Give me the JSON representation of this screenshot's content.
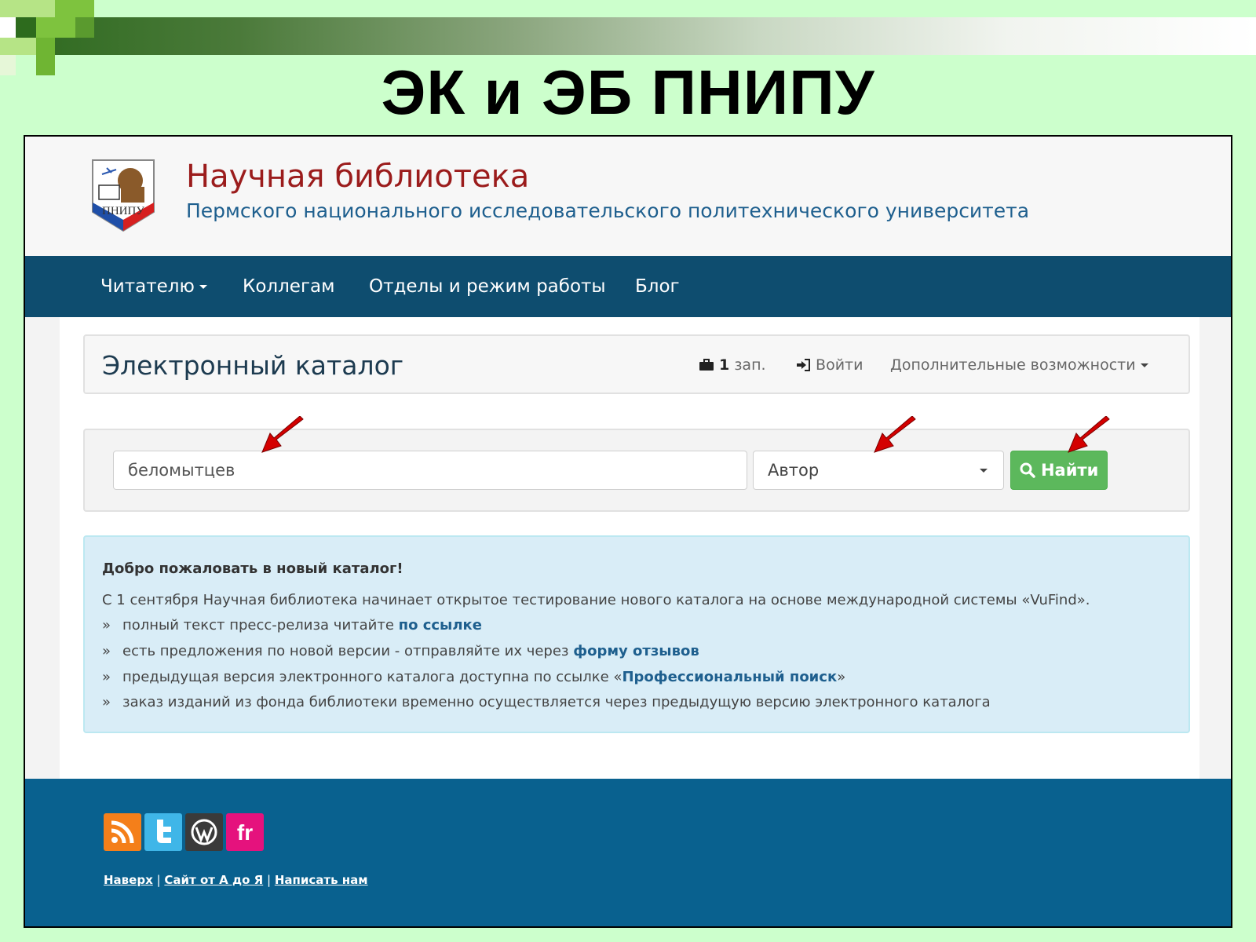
{
  "slide": {
    "title": "ЭК и ЭБ ПНИПУ"
  },
  "header": {
    "logo_text": "ПНИПУ",
    "title": "Научная библиотека",
    "subtitle": "Пермского национального исследовательского политехнического университета"
  },
  "nav": {
    "items": [
      "Читателю",
      "Коллегам",
      "Отделы и режим работы",
      "Блог"
    ]
  },
  "catalog": {
    "title": "Электронный каталог",
    "cart_count": "1",
    "cart_unit": "зап.",
    "login": "Войти",
    "more": "Дополнительные возможности"
  },
  "search": {
    "value": "беломытцев",
    "field": "Автор",
    "button": "Найти"
  },
  "info": {
    "heading": "Добро пожаловать в новый каталог!",
    "intro": "С 1 сентября Научная библиотека начинает открытое тестирование нового каталога на основе международной системы «VuFind».",
    "bullet": "»",
    "line1_text": "полный текст пресс-релиза читайте ",
    "line1_link": "по ссылке",
    "line2_text": "есть предложения по новой версии - отправляйте их через ",
    "line2_link": "форму отзывов",
    "line3_text": "предыдущая версия электронного каталога доступна по ссылке «",
    "line3_link": "Профессиональный поиск",
    "line3_end": "»",
    "line4_text": "заказ изданий из фонда библиотеки временно осуществляется через предыдущую версию электронного каталога"
  },
  "footer": {
    "social": [
      "rss-icon",
      "twitter-icon",
      "wordpress-icon",
      "fr-icon"
    ],
    "fr_label": "fr",
    "link_top": "Наверх",
    "link_az": "Сайт от А до Я",
    "link_write": "Написать нам",
    "sep": "|"
  },
  "colors": {
    "slide_bg": "#ccffcc",
    "nav_bg": "#0e4d6f",
    "footer_bg": "#09618f",
    "button_green": "#5cb85c",
    "title_red": "#9b1c1c",
    "link_blue": "#1e5f8e",
    "arrow_red": "#d40000"
  }
}
